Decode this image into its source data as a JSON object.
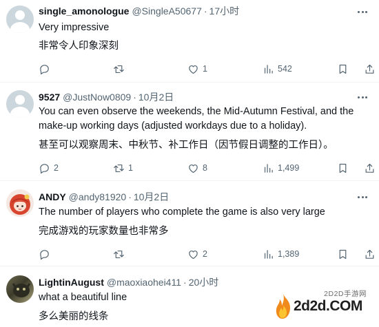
{
  "tweets": [
    {
      "name": "single_amonologue",
      "handle": "@SingleA50677",
      "sep": "·",
      "time": "17小时",
      "text_en": "Very impressive",
      "text_cn": "非常令人印象深刻",
      "replies": "",
      "retweets": "",
      "likes": "1",
      "views": "542"
    },
    {
      "name": "9527",
      "handle": "@JustNow0809",
      "sep": "·",
      "time": "10月2日",
      "text_en": "You can even observe the weekends, the Mid-Autumn Festival, and the make-up working days (adjusted workdays due to a holiday).",
      "text_cn": "甚至可以观察周末、中秋节、补工作日（因节假日调整的工作日）。",
      "replies": "2",
      "retweets": "1",
      "likes": "8",
      "views": "1,499"
    },
    {
      "name": "ANDY",
      "handle": "@andy81920",
      "sep": "·",
      "time": "10月2日",
      "text_en": "The number of players who complete the game is also very large",
      "text_cn": "完成游戏的玩家数量也非常多",
      "replies": "",
      "retweets": "",
      "likes": "2",
      "views": "1,389"
    },
    {
      "name": "LightinAugust",
      "handle": "@maoxiaohei411",
      "sep": "·",
      "time": "20小时",
      "text_en": "what a beautiful line",
      "text_cn": "多么美丽的线条"
    }
  ],
  "watermark": {
    "top": "2D2D手游网",
    "main": "2d2d.COM"
  },
  "colors": {
    "text": "#0f1419",
    "secondary": "#536471",
    "divider": "#eff3f4"
  }
}
